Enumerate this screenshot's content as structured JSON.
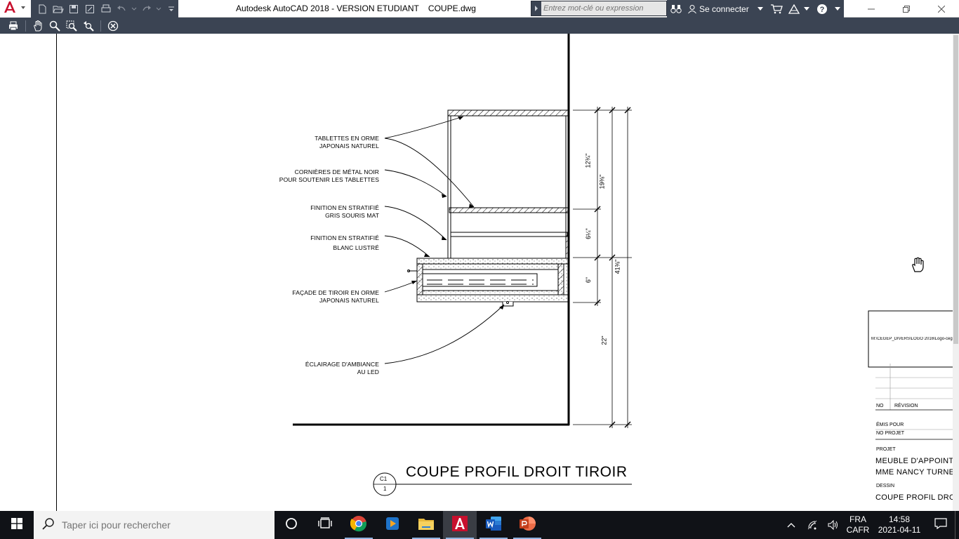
{
  "window": {
    "title": "Autodesk AutoCAD 2018 - VERSION ETUDIANT    COUPE.dwg"
  },
  "search": {
    "placeholder": "Entrez mot-clé ou expression"
  },
  "help_group": {
    "signin_label": "Se connecter"
  },
  "drawing": {
    "annotations": [
      {
        "line1": "TABLETTES EN ORME",
        "line2": "JAPONAIS NATUREL"
      },
      {
        "line1": "CORNIÈRES DE MÉTAL NOIR",
        "line2": "POUR SOUTENIR LES TABLETTES"
      },
      {
        "line1": "FINITION EN STRATIFIÉ",
        "line2": "GRIS SOURIS MAT"
      },
      {
        "line1": "FINITION EN STRATIFIÉ",
        "line2": "BLANC LUSTRÉ"
      },
      {
        "line1": "FAÇADE DE TIROIR EN ORME",
        "line2": "JAPONAIS NATUREL"
      },
      {
        "line1": "ÉCLAIRAGE D'AMBIANCE",
        "line2": "AU LED"
      }
    ],
    "dimensions": {
      "d1": "12¾\"",
      "d2": "19⅜\"",
      "d3": "6¼\"",
      "d4": "6\"",
      "d5": "22\"",
      "d6": "41⅜\""
    },
    "section_tag": {
      "top": "C1",
      "bottom": "1"
    },
    "section_title": "COUPE PROFIL DROIT TIROIR"
  },
  "title_block": {
    "logo_path": "M:\\CEGEP_DIVERS\\LOGO 2016\\Logo-cege",
    "no_label": "NO",
    "revision_label": "RÉVISION",
    "emis_label": "ÉMIS POUR",
    "no_projet_label": "NO PROJET",
    "projet_label": "PROJET",
    "projet_line1": "MEUBLE D'APPOINT",
    "projet_line2": "MME NANCY TURNER",
    "dessin_label": "DESSIN",
    "dessin_value": "COUPE PROFIL DROI"
  },
  "taskbar": {
    "search_placeholder": "Taper ici pour rechercher",
    "lang_line1": "FRA",
    "lang_line2": "CAFR",
    "time": "14:58",
    "date": "2021-04-11"
  },
  "colors": {
    "toolbar_bg": "#3b4453",
    "autocad_red": "#c8102e",
    "taskbar_bg": "#101217"
  }
}
